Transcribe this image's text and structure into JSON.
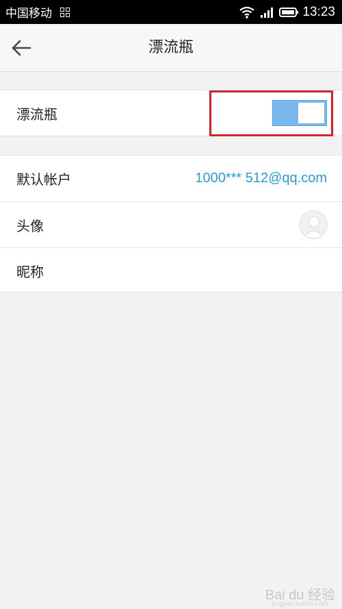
{
  "status_bar": {
    "carrier": "中国移动",
    "time": "13:23",
    "icons": [
      "grid-icon",
      "wifi-icon",
      "signal-icon",
      "battery-icon"
    ]
  },
  "header": {
    "title": "漂流瓶",
    "back_icon": "arrow-left-icon"
  },
  "settings": {
    "drift_bottle": {
      "label": "漂流瓶",
      "enabled": true
    },
    "default_account": {
      "label": "默认帐户",
      "value": "1000*** 512@qq.com"
    },
    "avatar": {
      "label": "头像",
      "icon": "default-avatar-icon"
    },
    "nickname": {
      "label": "昵称"
    }
  },
  "watermark": {
    "text": "Bai du 经验",
    "url": "jingyan.baidu.com"
  },
  "colors": {
    "toggle_on": "#7ab7ec",
    "highlight": "#c9282e",
    "link": "#2a9bd8"
  }
}
